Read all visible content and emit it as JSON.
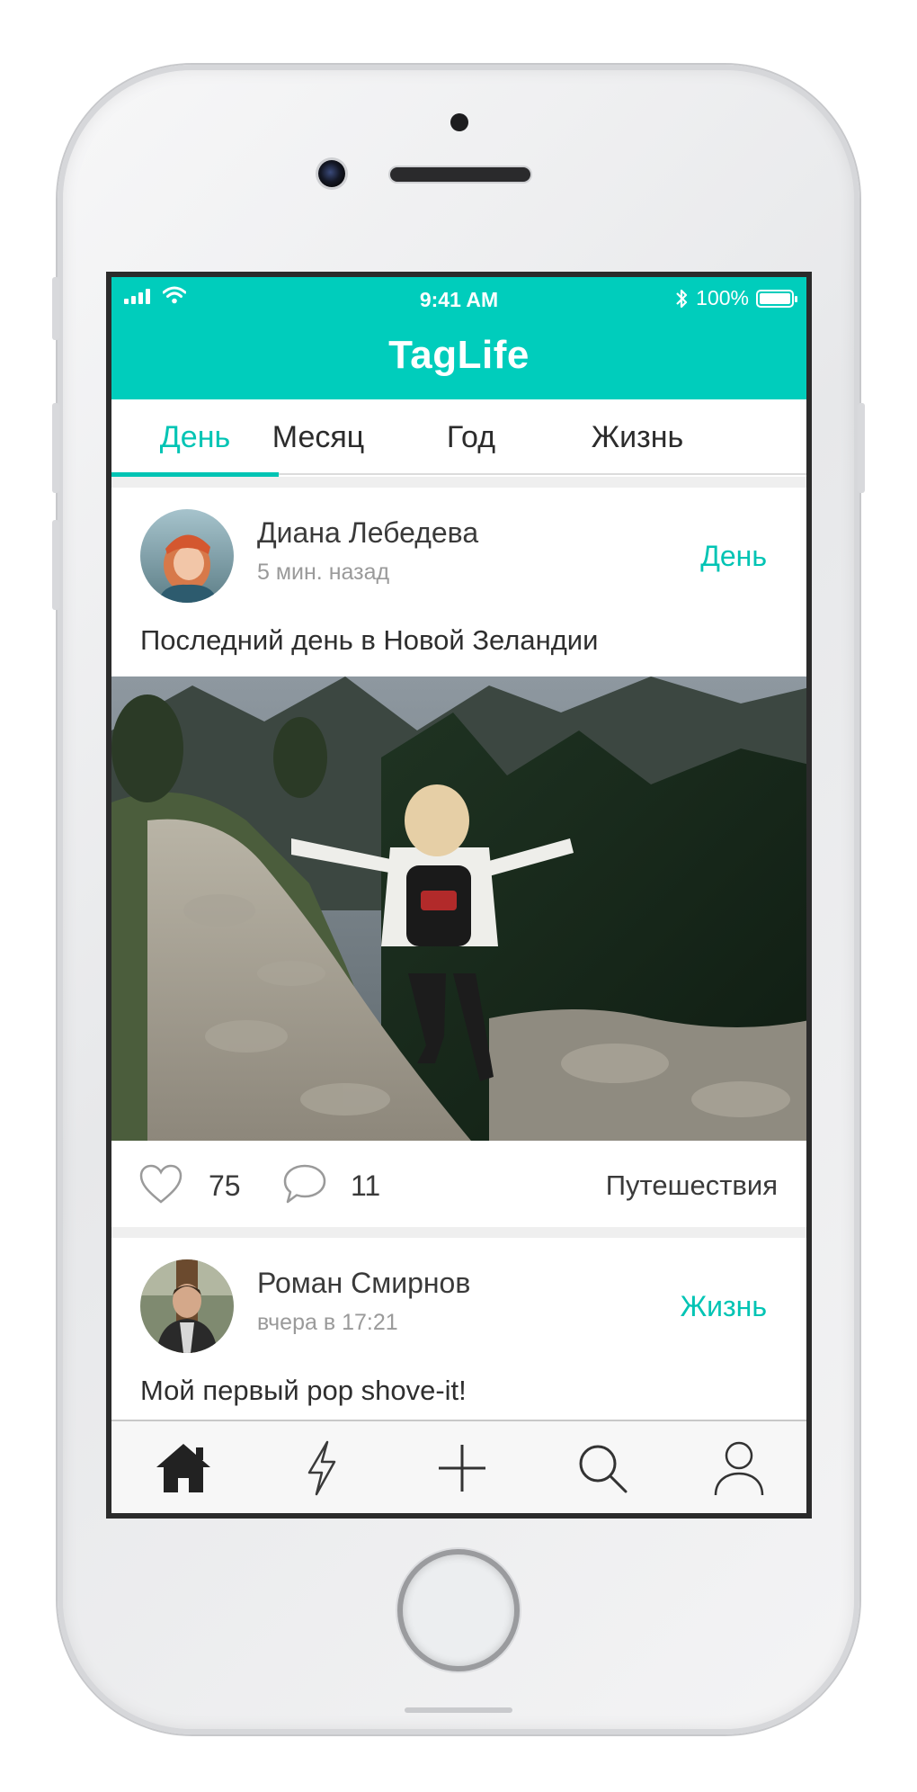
{
  "status_bar": {
    "time": "9:41 AM",
    "battery": "100%"
  },
  "app": {
    "title": "TagLife"
  },
  "tabs": [
    {
      "label": "День",
      "active": true
    },
    {
      "label": "Месяц",
      "active": false
    },
    {
      "label": "Год",
      "active": false
    },
    {
      "label": "Жизнь",
      "active": false
    }
  ],
  "posts": [
    {
      "author": "Диана Лебедева",
      "time": "5 мин. назад",
      "tag": "День",
      "text": "Последний день в Новой Зеландии",
      "likes": "75",
      "comments": "11",
      "category": "Путешествия"
    },
    {
      "author": "Роман Смирнов",
      "time": "вчера в 17:21",
      "tag": "Жизнь",
      "text": "Мой первый pop shove-it!"
    }
  ],
  "tab_bar": {
    "items": [
      {
        "icon": "home-icon",
        "active": true
      },
      {
        "icon": "lightning-icon",
        "active": false
      },
      {
        "icon": "plus-icon",
        "active": false
      },
      {
        "icon": "search-icon",
        "active": false
      },
      {
        "icon": "profile-icon",
        "active": false
      }
    ]
  },
  "colors": {
    "accent": "#00cdbc",
    "accent_text": "#00c4b4",
    "text": "#2e2e2e",
    "muted": "#9a9a9a"
  }
}
